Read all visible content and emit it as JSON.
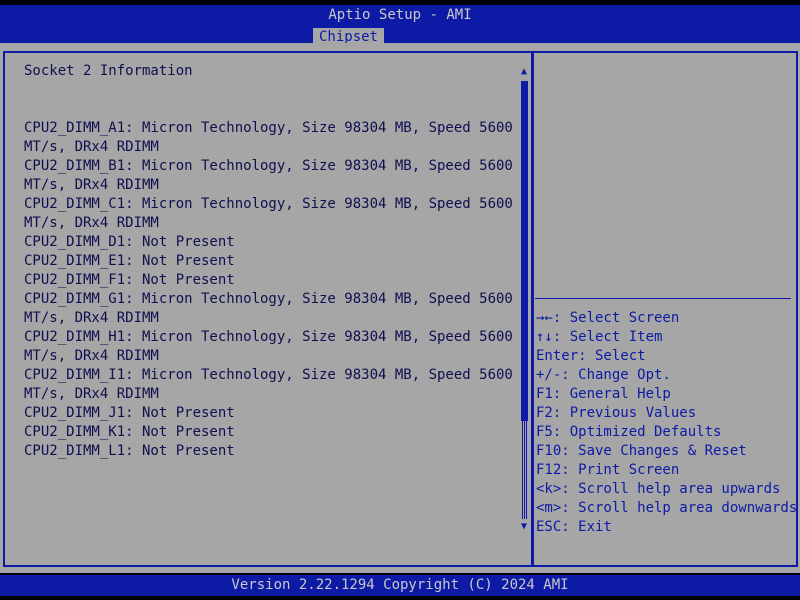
{
  "header": {
    "title": "Aptio Setup - AMI",
    "active_tab": "Chipset"
  },
  "main": {
    "section_title": "Socket 2 Information",
    "lines": [
      "CPU2_DIMM_A1: Micron Technology, Size 98304 MB, Speed 5600",
      "MT/s, DRx4 RDIMM",
      "CPU2_DIMM_B1: Micron Technology, Size 98304 MB, Speed 5600",
      "MT/s, DRx4 RDIMM",
      "CPU2_DIMM_C1: Micron Technology, Size 98304 MB, Speed 5600",
      "MT/s, DRx4 RDIMM",
      "CPU2_DIMM_D1: Not Present",
      "CPU2_DIMM_E1: Not Present",
      "CPU2_DIMM_F1: Not Present",
      "CPU2_DIMM_G1: Micron Technology, Size 98304 MB, Speed 5600",
      "MT/s, DRx4 RDIMM",
      "CPU2_DIMM_H1: Micron Technology, Size 98304 MB, Speed 5600",
      "MT/s, DRx4 RDIMM",
      "CPU2_DIMM_I1: Micron Technology, Size 98304 MB, Speed 5600",
      "MT/s, DRx4 RDIMM",
      "CPU2_DIMM_J1: Not Present",
      "CPU2_DIMM_K1: Not Present",
      "CPU2_DIMM_L1: Not Present"
    ],
    "scroll_up_glyph": "▲",
    "scroll_down_glyph": "▼"
  },
  "help": {
    "keys": [
      "→←: Select Screen",
      "↑↓: Select Item",
      "Enter: Select",
      "+/-: Change Opt.",
      "F1: General Help",
      "F2: Previous Values",
      "F5: Optimized Defaults",
      "F10: Save Changes & Reset",
      "F12: Print Screen",
      "<k>: Scroll help area upwards",
      "<m>: Scroll help area downwards",
      "ESC: Exit"
    ]
  },
  "footer": {
    "version": "Version 2.22.1294 Copyright (C) 2024 AMI"
  },
  "colors": {
    "bios_blue": "#0c1aa5",
    "panel_gray": "#a6a6a6",
    "header_text": "#c9c9c9",
    "body_text": "#0f0f50"
  }
}
